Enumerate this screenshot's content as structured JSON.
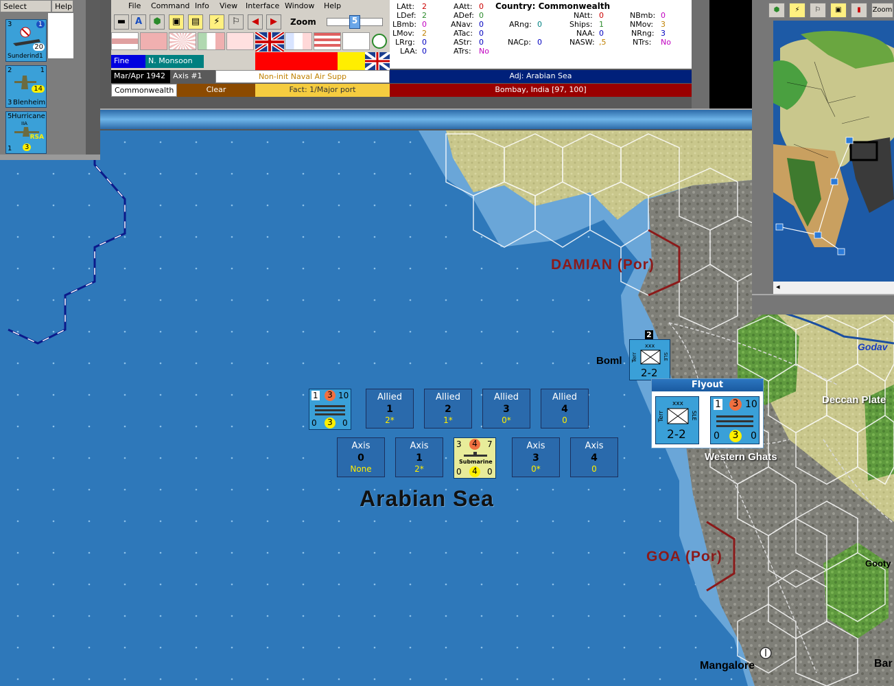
{
  "left_panel": {
    "select_label": "Select",
    "help_label": "Help",
    "units": [
      {
        "top_left": "3",
        "top_right": "1",
        "bottom_right": "20",
        "name": "Sunderind1"
      },
      {
        "top_left": "2",
        "top_right": "1",
        "bottom_left": "3",
        "bottom_right": "14",
        "name": "Blenheim"
      },
      {
        "top_left": "5",
        "name": "Hurricane",
        "sub": "IIA",
        "nation": "RSA",
        "bottom_left": "1",
        "bottom_right": "3"
      }
    ]
  },
  "menu": [
    "File",
    "Command",
    "Info",
    "View",
    "Interface",
    "Window",
    "Help"
  ],
  "zoom": {
    "label": "Zoom",
    "value": "5"
  },
  "status": {
    "weather": "Fine",
    "monsoon": "N. Monsoon",
    "date": "Mar/Apr 1942",
    "impulse": "Axis #1",
    "action": "Non-init Naval Air Supp",
    "adj": "Adj: Arabian Sea",
    "country": "Commonwealth",
    "weather2": "Clear",
    "factory": "Fact: 1/Major port",
    "location": "Bombay, India [97, 100]"
  },
  "stats": {
    "country": "Country: Commonwealth",
    "col1": [
      [
        "LAtt:",
        "2"
      ],
      [
        "LDef:",
        "2"
      ],
      [
        "LBmb:",
        "0"
      ],
      [
        "LMov:",
        "2"
      ],
      [
        "LRrg:",
        "0"
      ],
      [
        "LAA:",
        "0"
      ]
    ],
    "col2": [
      [
        "AAtt:",
        "0"
      ],
      [
        "ADef:",
        "0"
      ],
      [
        "ANav:",
        "0"
      ],
      [
        "ATac:",
        "0"
      ],
      [
        "AStr:",
        "0"
      ],
      [
        "ATrs:",
        "No"
      ]
    ],
    "col3": [
      [
        "ARng:",
        "0"
      ],
      [
        "NACp:",
        "0"
      ]
    ],
    "col4": [
      [
        "NAtt:",
        "0"
      ],
      [
        "Ships:",
        "1"
      ],
      [
        "NAA:",
        "0"
      ],
      [
        "NASW:",
        ",5"
      ]
    ],
    "col5": [
      [
        "NBmb:",
        "0"
      ],
      [
        "NMov:",
        "3"
      ],
      [
        "NRng:",
        "3"
      ],
      [
        "NTrs:",
        "No"
      ]
    ]
  },
  "minimap": {
    "zoom_label": "Zoom"
  },
  "map": {
    "sea_name": "Arabian Sea",
    "labels": {
      "damian": "DAMIAN (Por)",
      "goa": "GOA (Por)",
      "bombay": "Boml",
      "deccan": "Deccan Plate",
      "western_ghats": "Western Ghats",
      "godav": "Godav",
      "mangalore": "Mangalore",
      "gooty": "Gooty",
      "bar": "Bar"
    },
    "allied_boxes": [
      {
        "title": "Allied",
        "num": "1",
        "val": "2*"
      },
      {
        "title": "Allied",
        "num": "2",
        "val": "1*"
      },
      {
        "title": "Allied",
        "num": "3",
        "val": "0*"
      },
      {
        "title": "Allied",
        "num": "4",
        "val": "0"
      }
    ],
    "axis_boxes": [
      {
        "title": "Axis",
        "num": "0",
        "val": "None"
      },
      {
        "title": "Axis",
        "num": "1",
        "val": "2*"
      },
      {
        "title": "Axis",
        "num": "3",
        "val": "0*"
      },
      {
        "title": "Axis",
        "num": "4",
        "val": "0"
      }
    ],
    "ship_counter": {
      "tl": "1",
      "tm": "3",
      "tr": "10",
      "bl": "0",
      "bm": "3",
      "br": "0"
    },
    "sub_counter": {
      "tl": "3",
      "tm": "4",
      "tr": "7",
      "label": "Submarine",
      "bl": "0",
      "bm": "4",
      "br": "0"
    },
    "corps_counter": {
      "stack": "2",
      "size": "xxx",
      "type": "Terr",
      "side": "SLE",
      "value": "2-2"
    }
  },
  "flyout": {
    "title": "Flyout",
    "corps": {
      "size": "xxx",
      "type": "Terr",
      "side": "SLE",
      "value": "2-2"
    },
    "ship": {
      "tl": "1",
      "tm": "3",
      "tr": "10",
      "bl": "0",
      "bm": "3",
      "br": "0"
    }
  },
  "colors": {
    "sea": "#2e78ba",
    "coastal": "#7bb3e0",
    "border_red": "#8b1a1a",
    "allied_blue": "#3aa0d8"
  }
}
